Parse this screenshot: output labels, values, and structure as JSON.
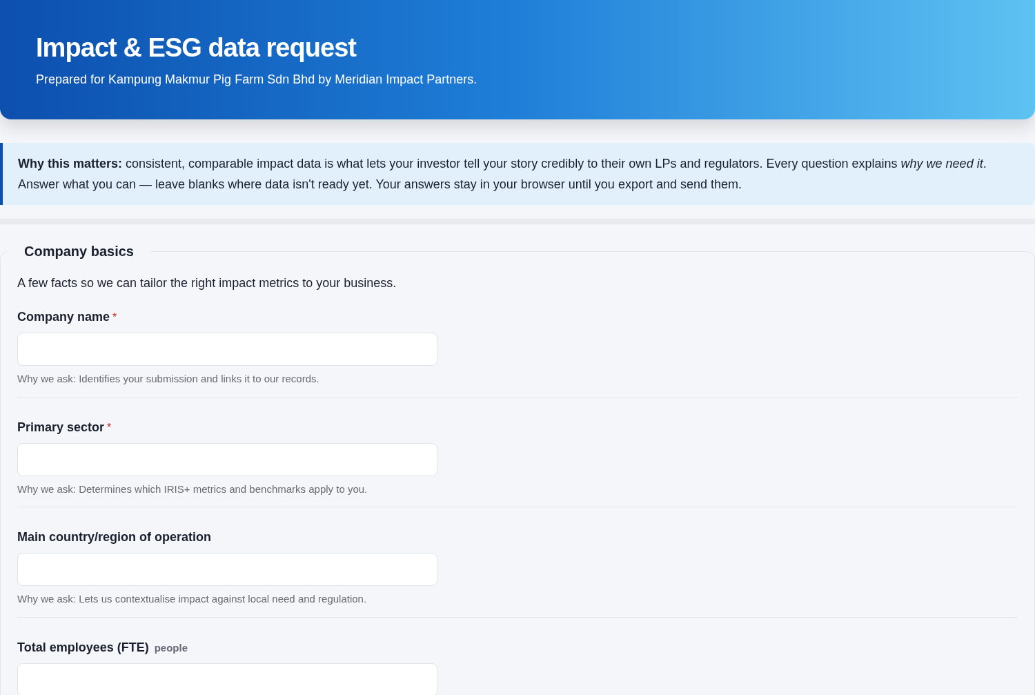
{
  "header": {
    "title": "Impact & ESG data request",
    "subtitle": "Prepared for Kampung Makmur Pig Farm Sdn Bhd by Meridian Impact Partners."
  },
  "notice": {
    "text": "**Why this matters:** consistent, comparable impact data is what lets your investor tell your story credibly to their own LPs and regulators. Every question explains *why we need it*. Answer what you can — leave blanks where data isn't ready yet. Your answers stay in your browser until you export and send them."
  },
  "section": {
    "title": "Company basics",
    "required_marker": "*",
    "intro": "A few facts so we can tailor the right impact metrics to your business.",
    "fields": [
      {
        "label": "Company name",
        "required": true,
        "help": "Why we ask: Identifies your submission and links it to our records."
      },
      {
        "label": "Primary sector",
        "required": true,
        "help": "Why we ask: Determines which IRIS+ metrics and benchmarks apply to you."
      },
      {
        "label": "Main country/region of operation",
        "required": false,
        "help": "Why we ask: Lets us contextualise impact against local need and regulation."
      },
      {
        "label": "Total employees (FTE)",
        "required": false,
        "unit": "people"
      }
    ]
  }
}
